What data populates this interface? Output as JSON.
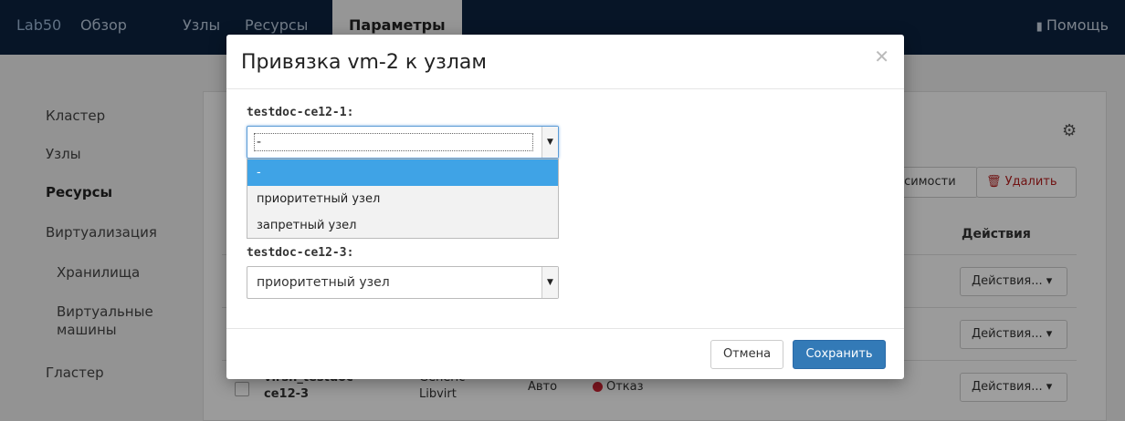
{
  "navbar": {
    "brand": "Lab50",
    "links": [
      "Обзор",
      "Узлы",
      "Ресурсы",
      "Параметры"
    ],
    "active_link": "Параметры",
    "help_label": "Помощь",
    "help_icon": "book-icon"
  },
  "sidebar": {
    "items": [
      {
        "label": "Кластер"
      },
      {
        "label": "Узлы"
      },
      {
        "label": "Ресурсы"
      },
      {
        "label": "Виртуализация"
      },
      {
        "label": "Хранилища"
      },
      {
        "label": "Виртуальные машины"
      },
      {
        "label": "Гластер"
      }
    ],
    "active_item": "Ресурсы"
  },
  "background_panel": {
    "gear_icon": "gear-icon",
    "dependencies_label": "висимости",
    "delete_label": "Удалить",
    "delete_icon": "trash-icon",
    "actions_header": "Действия",
    "row_actions_label": "Действия...",
    "row3": {
      "name_line1": "virsh_testdoc",
      "name_line2": "ce12-3",
      "agent_line1": "Generic",
      "agent_line2": "Libvirt",
      "mode": "Авто",
      "status": "Отказ"
    }
  },
  "modal": {
    "title": "Привязка vm-2 к узлам",
    "close_icon": "close-icon",
    "field1": {
      "label": "testdoc-ce12-1:",
      "value": "-"
    },
    "dropdown_options": [
      "-",
      "приоритетный узел",
      "запретный узел"
    ],
    "dropdown_selected": "-",
    "field3": {
      "label": "testdoc-ce12-3:",
      "value": "приоритетный узел"
    },
    "cancel_label": "Отмена",
    "save_label": "Сохранить"
  },
  "colors": {
    "navbar_bg": "#0c2340",
    "accent": "#337ab7",
    "dropdown_highlight": "#3fa3e6",
    "status_failed": "#cc2233"
  }
}
